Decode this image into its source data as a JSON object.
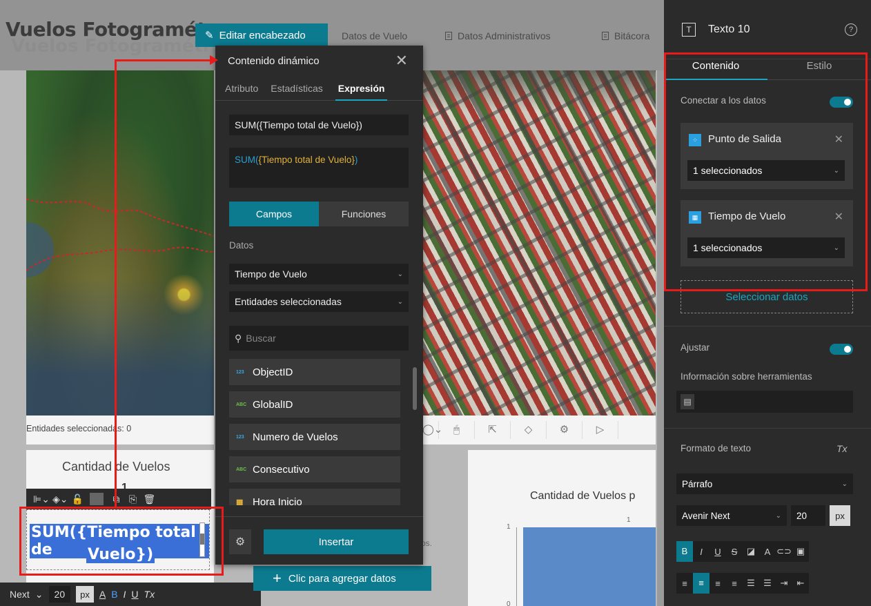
{
  "header": {
    "app_title": "Vuelos Fotogramétr",
    "app_title_ghost": "Vuelos Fotogramétricos",
    "edit_header_label": "Editar encabezado",
    "nav": [
      "Datos de Vuelo",
      "Datos Administrativos",
      "Bitácora"
    ]
  },
  "map": {
    "status_text": "Entidades seleccionadas: 0",
    "tools": [
      "◯⌄",
      "🖱",
      "⇱",
      "◇",
      "⚙",
      "▷"
    ]
  },
  "count_widget": {
    "title": "Cantidad de Vuelos",
    "value": "1"
  },
  "chart_widget": {
    "title": "Cantidad de Vuelos p",
    "top_label": "1",
    "y_tick_top": "1",
    "y_tick_bottom": "0"
  },
  "chart_data": {
    "type": "bar",
    "title": "Cantidad de Vuelos p",
    "categories": [
      ""
    ],
    "values": [
      1
    ],
    "ylim": [
      0,
      1
    ]
  },
  "text_widget": {
    "line1": "SUM({Tiempo total de",
    "line2": "Vuelo})"
  },
  "widget_toolbar": {
    "items": [
      "⊫⌄",
      "◈⌄",
      "🔓",
      "⧉",
      "⎘",
      "🗑"
    ]
  },
  "format_bar": {
    "font": "Next",
    "size": "20",
    "unit": "px",
    "buttons": [
      "A",
      "B",
      "I",
      "U",
      "Tx"
    ]
  },
  "add_data_label": "Clic para agregar datos",
  "behind_text": "os.",
  "popup": {
    "title": "Contenido dinámico",
    "tabs": [
      "Atributo",
      "Estadísticas",
      "Expresión"
    ],
    "expression": "SUM({Tiempo total de Vuelo})",
    "preview_fn": "SUM(",
    "preview_arg": "{Tiempo total de Vuelo}",
    "preview_close": ")",
    "seg_fields": "Campos",
    "seg_functions": "Funciones",
    "data_label": "Datos",
    "source": "Tiempo de Vuelo",
    "entities": "Entidades seleccionadas",
    "search_placeholder": "Buscar",
    "fields": [
      {
        "type": "123",
        "name": "ObjectID"
      },
      {
        "type": "ABC",
        "name": "GlobalID"
      },
      {
        "type": "123",
        "name": "Numero de Vuelos"
      },
      {
        "type": "ABC",
        "name": "Consecutivo"
      },
      {
        "type": "▦",
        "name": "Hora Inicio"
      }
    ],
    "insert_label": "Insertar"
  },
  "panel": {
    "title": "Texto 10",
    "tab_content": "Contenido",
    "tab_style": "Estilo",
    "connect_label": "Conectar a los datos",
    "sources": [
      {
        "name": "Punto de Salida",
        "selected": "1 seleccionados"
      },
      {
        "name": "Tiempo de Vuelo",
        "selected": "1 seleccionados"
      }
    ],
    "select_data": "Seleccionar datos",
    "adjust_label": "Ajustar",
    "tooltip_label": "Información sobre herramientas",
    "text_format_label": "Formato de texto",
    "paragraph": "Párrafo",
    "font_family": "Avenir Next",
    "font_size": "20",
    "font_unit": "px",
    "style_buttons": [
      "B",
      "I",
      "U",
      "S",
      "◪",
      "A",
      "⊂⊃",
      "▣"
    ],
    "align_buttons": [
      "≡",
      "≡",
      "≡",
      "≡",
      "☰",
      "☰",
      "⇥",
      "⇤"
    ]
  },
  "colors": {
    "accent": "#0c7b90",
    "highlight_box": "#e81b1b",
    "panel_bg": "#2b2b2b"
  }
}
